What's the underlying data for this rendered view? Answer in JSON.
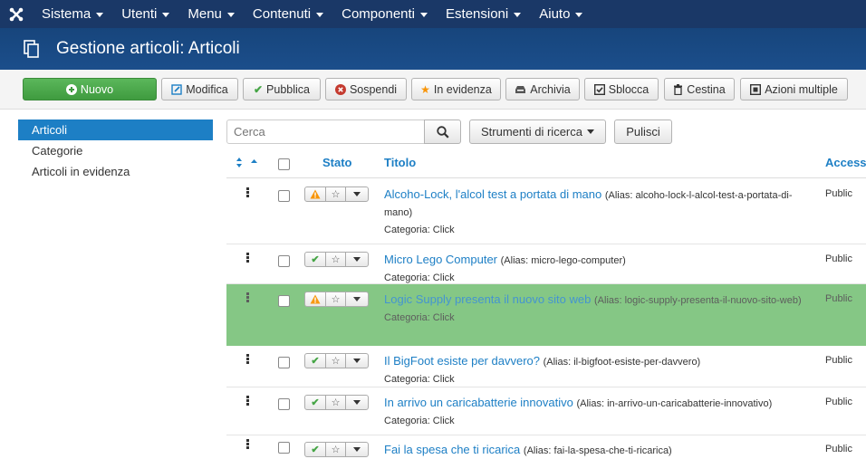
{
  "nav": {
    "items": [
      {
        "label": "Sistema"
      },
      {
        "label": "Utenti"
      },
      {
        "label": "Menu"
      },
      {
        "label": "Contenuti"
      },
      {
        "label": "Componenti"
      },
      {
        "label": "Estensioni"
      },
      {
        "label": "Aiuto"
      }
    ]
  },
  "header": {
    "title": "Gestione articoli: Articoli"
  },
  "toolbar": {
    "new_label": "Nuovo",
    "edit_label": "Modifica",
    "publish_label": "Pubblica",
    "unpublish_label": "Sospendi",
    "featured_label": "In evidenza",
    "archive_label": "Archivia",
    "checkin_label": "Sblocca",
    "trash_label": "Cestina",
    "batch_label": "Azioni multiple"
  },
  "sidebar": {
    "items": [
      {
        "label": "Articoli",
        "active": true
      },
      {
        "label": "Categorie",
        "active": false
      },
      {
        "label": "Articoli in evidenza",
        "active": false
      }
    ]
  },
  "search": {
    "placeholder": "Cerca",
    "tools_label": "Strumenti di ricerca",
    "clear_label": "Pulisci"
  },
  "table": {
    "headers": {
      "status": "Stato",
      "title": "Titolo",
      "access": "Access"
    },
    "rows": [
      {
        "status": "warning",
        "title": "Alcoho-Lock, l'alcol test a portata di mano",
        "alias": "(Alias: alcoho-lock-l-alcol-test-a-portata-di-mano)",
        "category": "Categoria: Click",
        "access": "Public"
      },
      {
        "status": "published",
        "title": "Micro Lego Computer",
        "alias": "(Alias: micro-lego-computer)",
        "category": "Categoria: Click",
        "access": "Public"
      },
      {
        "status": "warning",
        "title": "Logic Supply presenta il nuovo sito web",
        "alias": "(Alias: logic-supply-presenta-il-nuovo-sito-web)",
        "category": "Categoria: Click",
        "access": "Public",
        "dragging": true
      },
      {
        "status": "published",
        "title": "Il BigFoot esiste per davvero?",
        "alias": "(Alias: il-bigfoot-esiste-per-davvero)",
        "category": "Categoria: Click",
        "access": "Public"
      },
      {
        "status": "published",
        "title": "In arrivo un caricabatterie innovativo",
        "alias": "(Alias: in-arrivo-un-caricabatterie-innovativo)",
        "category": "Categoria: Click",
        "access": "Public"
      },
      {
        "status": "published",
        "title": "Fai la spesa che ti ricarica",
        "alias": "(Alias: fai-la-spesa-che-ti-ricarica)",
        "category": "",
        "access": "Public"
      }
    ]
  },
  "colors": {
    "navbar": "#1a3867",
    "header": "#1b4e8b",
    "accent": "#1d7fc5",
    "success": "#46a546",
    "drag_row": "#7fc57f",
    "warning": "#f89406"
  }
}
